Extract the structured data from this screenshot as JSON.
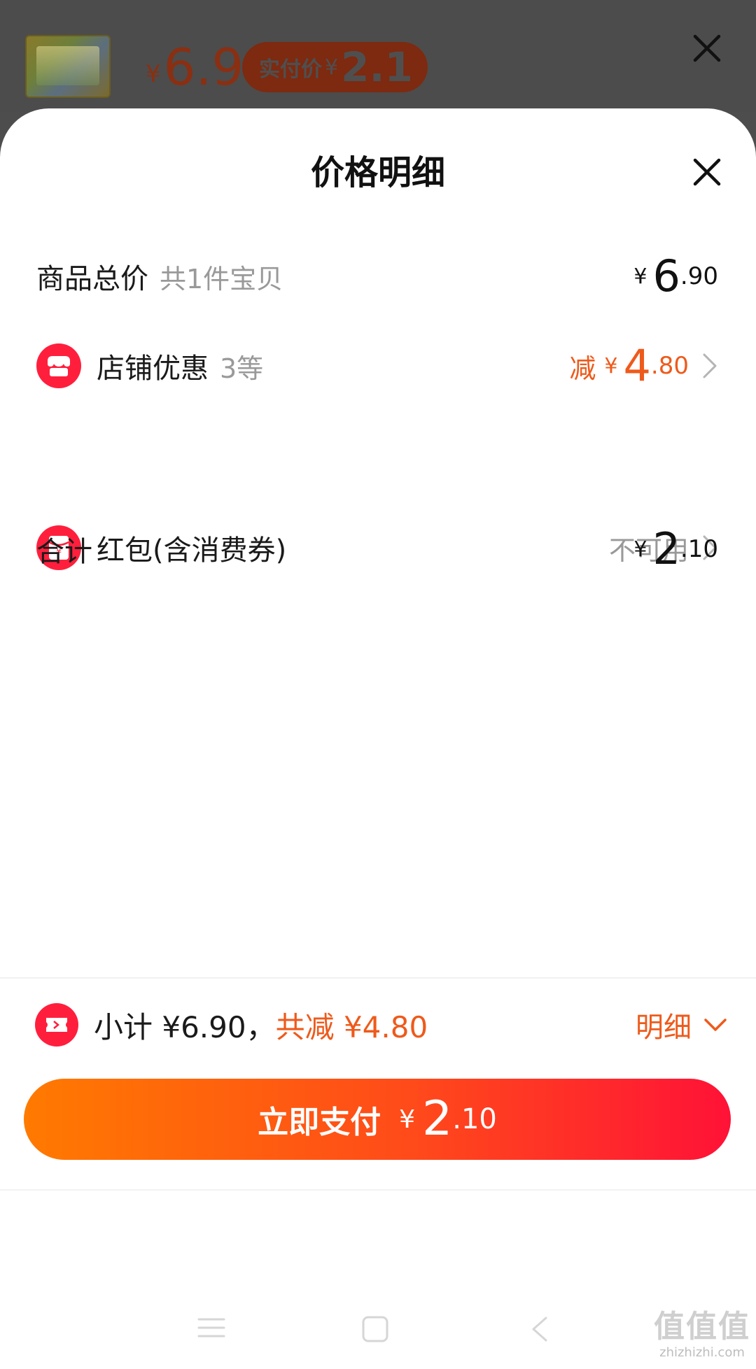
{
  "header": {
    "price_yen": "¥",
    "price": "6.9",
    "pay_label": "实付价",
    "pay_yen": "¥",
    "pay_price": "2.1"
  },
  "sheet": {
    "title": "价格明细"
  },
  "rows": {
    "total": {
      "label": "商品总价",
      "sub": "共1件宝贝",
      "yen": "¥",
      "int": "6",
      "dec": ".90"
    },
    "shop": {
      "label": "店铺优惠",
      "sub": "3等",
      "prefix": "减",
      "yen": "¥",
      "int": "4",
      "dec": ".80"
    },
    "redpacket": {
      "label": "红包(含消费券)",
      "status": "不可用"
    },
    "sum": {
      "label": "合计",
      "yen": "¥",
      "int": "2",
      "dec": ".10"
    }
  },
  "summary": {
    "subtotal_text": "小计 ¥6.90，",
    "discount_text": "共减 ¥4.80",
    "detail_label": "明细"
  },
  "pay_button": {
    "label": "立即支付",
    "yen": "¥",
    "int": "2",
    "dec": ".10"
  },
  "watermark": {
    "title": "值值值",
    "url": "zhizhizhi.com"
  },
  "colors": {
    "accent": "#ee5a1b",
    "brand_red": "#ff1f3d",
    "button_start": "#ff7a00",
    "button_end": "#ff1237"
  }
}
